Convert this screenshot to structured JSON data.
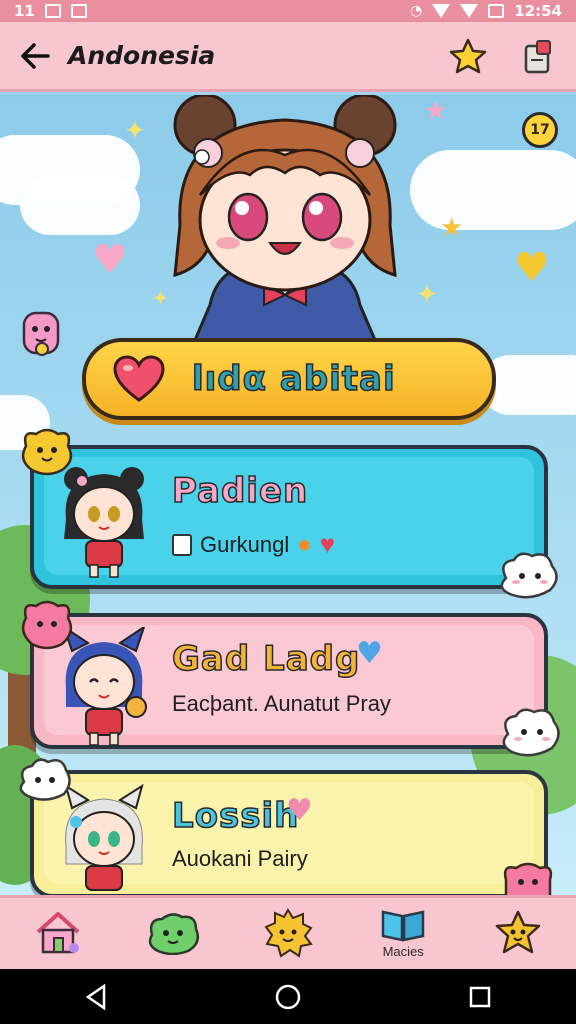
{
  "status_bar": {
    "left_text": "11",
    "time": "12:54"
  },
  "app_bar": {
    "title": "Andonesia",
    "back_icon": "arrow-left-icon",
    "favorite_icon": "star-icon",
    "share_icon": "share-icon"
  },
  "hero": {
    "help_badge": "17",
    "banner_text": "lıdα abitai"
  },
  "cards": [
    {
      "title": "Padien",
      "subtitle": "Gurkungl",
      "color": "#49d2ea"
    },
    {
      "title": "Gad Ladg",
      "subtitle": "Eacþant. Aunatut Pray",
      "color": "#fbc9d4"
    },
    {
      "title": "Lossih",
      "subtitle": "Auokani Pairy",
      "color": "#faf3ac"
    }
  ],
  "bottom_nav": {
    "items": [
      {
        "icon": "house-icon",
        "label": ""
      },
      {
        "icon": "green-blob-icon",
        "label": ""
      },
      {
        "icon": "sun-face-icon",
        "label": ""
      },
      {
        "icon": "book-icon",
        "label": "Macies"
      },
      {
        "icon": "star-face-icon",
        "label": ""
      }
    ]
  },
  "colors": {
    "app_bar": "#f7c6cf",
    "status_bar": "#e98fa0",
    "banner": "#ffd447",
    "sky": "#8ccbea"
  }
}
